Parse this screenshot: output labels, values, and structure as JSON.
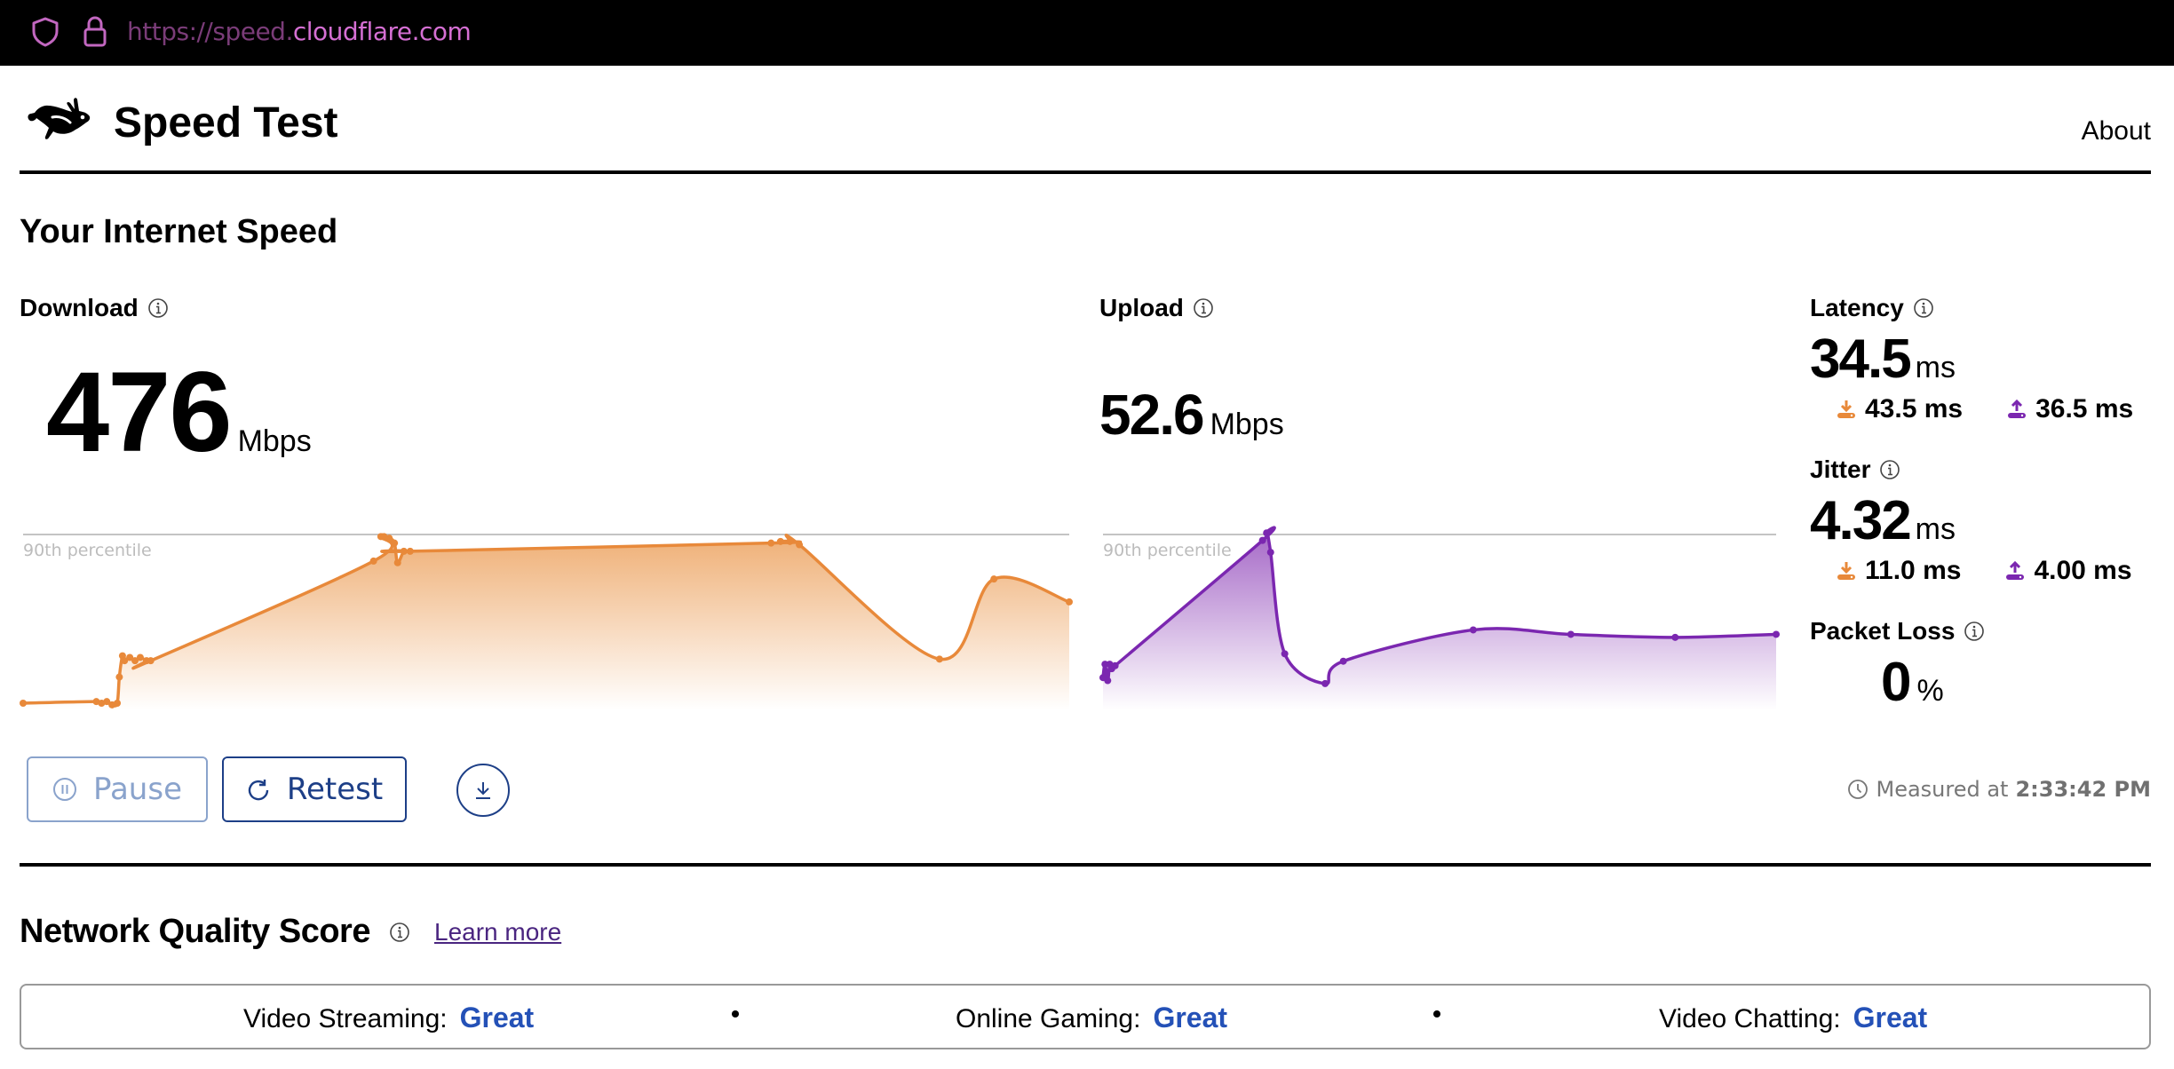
{
  "browser": {
    "url_scheme_host_dim": "https://speed.",
    "url_domain": "cloudflare.com",
    "icons": [
      "shield-icon",
      "lock-icon"
    ]
  },
  "header": {
    "title": "Speed Test",
    "logo": "rabbit-logo-icon",
    "nav_about": "About"
  },
  "section_title": "Your Internet Speed",
  "download": {
    "label": "Download",
    "value": "476",
    "unit": "Mbps",
    "color": "#e8893a"
  },
  "upload": {
    "label": "Upload",
    "value": "52.6",
    "unit": "Mbps",
    "color": "#7b27b0"
  },
  "latency": {
    "label": "Latency",
    "value": "34.5",
    "unit": "ms",
    "down_value": "43.5 ms",
    "up_value": "36.5 ms"
  },
  "jitter": {
    "label": "Jitter",
    "value": "4.32",
    "unit": "ms",
    "down_value": "11.0 ms",
    "up_value": "4.00 ms"
  },
  "packet_loss": {
    "label": "Packet Loss",
    "value": "0",
    "unit": "%"
  },
  "buttons": {
    "pause": "Pause",
    "retest": "Retest",
    "download_results": "download-results"
  },
  "measured": {
    "prefix": "Measured at",
    "time": "2:33:42 PM"
  },
  "network_quality": {
    "title": "Network Quality Score",
    "learn_more": "Learn more",
    "items": [
      {
        "label": "Video Streaming:",
        "value": "Great"
      },
      {
        "label": "Online Gaming:",
        "value": "Great"
      },
      {
        "label": "Video Chatting:",
        "value": "Great"
      }
    ]
  },
  "chart_data": [
    {
      "type": "area",
      "title": "Download",
      "reference_line_label": "90th percentile",
      "reference_line_value": 1.0,
      "note": "relative throughput over test duration (fraction of 90th percentile)",
      "x": [
        0,
        0.07,
        0.075,
        0.08,
        0.085,
        0.09,
        0.092,
        0.095,
        0.097,
        0.102,
        0.107,
        0.112,
        0.118,
        0.122,
        0.335,
        0.342,
        0.345,
        0.35,
        0.355,
        0.358,
        0.364,
        0.37,
        0.715,
        0.724,
        0.733,
        0.742,
        0.876,
        0.928,
        1.0
      ],
      "y": [
        0.0,
        0.01,
        0.0,
        0.01,
        -0.01,
        0.0,
        0.16,
        0.29,
        0.26,
        0.28,
        0.26,
        0.28,
        0.26,
        0.26,
        0.87,
        1.02,
        1.02,
        1.01,
        0.98,
        0.86,
        0.93,
        0.93,
        0.98,
        0.99,
        0.99,
        0.97,
        0.27,
        0.76,
        0.62
      ]
    },
    {
      "type": "area",
      "title": "Upload",
      "reference_line_label": "90th percentile",
      "reference_line_value": 1.0,
      "note": "relative throughput over test duration (fraction of 90th percentile)",
      "x": [
        0,
        0.003,
        0.007,
        0.01,
        0.013,
        0.018,
        0.237,
        0.243,
        0.249,
        0.27,
        0.33,
        0.357,
        0.55,
        0.695,
        0.85,
        1.0
      ],
      "y": [
        0.1,
        0.19,
        0.08,
        0.19,
        0.16,
        0.18,
        1.02,
        1.07,
        0.94,
        0.26,
        0.06,
        0.21,
        0.42,
        0.39,
        0.37,
        0.39
      ]
    }
  ]
}
